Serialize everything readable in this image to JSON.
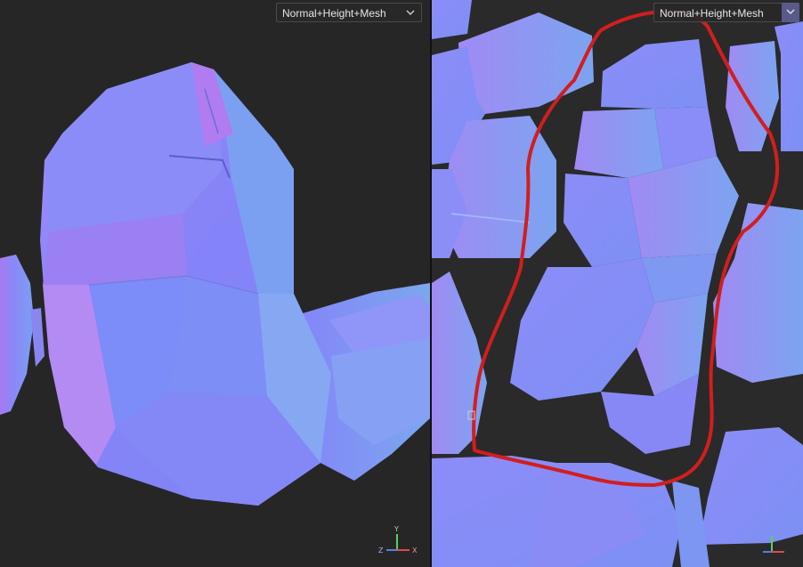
{
  "left_viewport": {
    "mode": "Normal+Height+Mesh",
    "axis_labels": {
      "y": "Y",
      "x": "X",
      "z": "Z"
    }
  },
  "right_viewport": {
    "mode": "Normal+Height+Mesh"
  },
  "colors": {
    "viewport_bg": "#262626",
    "normal_base": "#8a86f6",
    "annotation_red": "#d21e1e",
    "axis_y": "#5ad25a",
    "axis_x": "#e04848",
    "axis_z": "#5a7ae8"
  },
  "icons": {
    "dropdown": "chevron-down-icon",
    "axis_gizmo": "axis-gizmo-icon"
  }
}
